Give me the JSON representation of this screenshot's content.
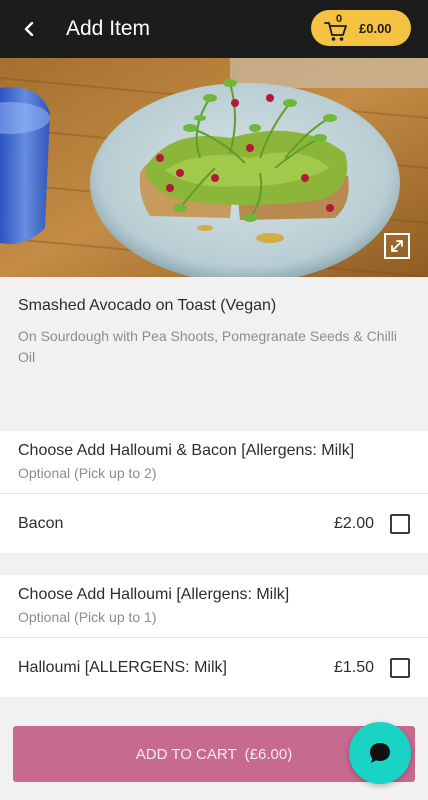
{
  "header": {
    "title": "Add Item",
    "cart": {
      "count": "0",
      "total": "£0.00"
    }
  },
  "product": {
    "name": "Smashed Avocado on Toast (Vegan)",
    "description": "On Sourdough with Pea Shoots, Pomegranate Seeds & Chilli Oil"
  },
  "option_groups": [
    {
      "title": "Choose Add Halloumi & Bacon [Allergens: Milk]",
      "subtitle": "Optional (Pick up to 2)",
      "options": [
        {
          "name": "Bacon",
          "price": "£2.00",
          "checked": false
        }
      ]
    },
    {
      "title": "Choose Add Halloumi [Allergens: Milk]",
      "subtitle": "Optional (Pick up to 1)",
      "options": [
        {
          "name": "Halloumi [ALLERGENS: Milk]",
          "price": "£1.50",
          "checked": false
        }
      ]
    }
  ],
  "add_to_cart": {
    "label": "ADD TO CART  (£6.00)"
  },
  "icons": {
    "back": "back-arrow-icon",
    "cart": "cart-icon",
    "expand": "expand-icon",
    "chat": "chat-bubble-icon"
  },
  "colors": {
    "header_bg": "#1c1c1c",
    "cart_pill": "#f5c242",
    "add_button": "#c76a8f",
    "chat_fab": "#19d3c5"
  }
}
